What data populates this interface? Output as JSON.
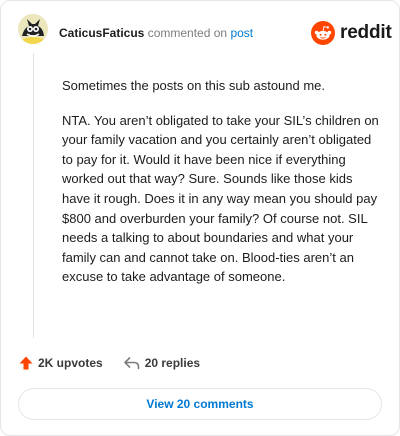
{
  "header": {
    "username": "CaticusFaticus",
    "verb": "commented on",
    "post_link": "post"
  },
  "brand": {
    "wordmark": "reddit",
    "color": "#ff4500"
  },
  "comment": {
    "paragraphs": [
      "Sometimes the posts on this sub astound me.",
      "NTA. You aren’t obligated to take your SIL’s children on your family vacation and you certainly aren’t obligated to pay for it. Would it have been nice if everything worked out that way? Sure. Sounds like those kids have it rough. Does it in any way mean you should pay $800 and overburden your family? Of course not. SIL needs a talking to about boundaries and what your family can and cannot take on. Blood-ties aren’t an excuse to take advantage of someone."
    ]
  },
  "actions": {
    "upvotes": "2K upvotes",
    "replies": "20 replies",
    "upvote_icon": "upvote-arrow-icon",
    "reply_icon": "reply-arrow-icon",
    "accent": "#ff4500"
  },
  "footer": {
    "view_comments": "View 20 comments",
    "link_color": "#0079d3"
  }
}
